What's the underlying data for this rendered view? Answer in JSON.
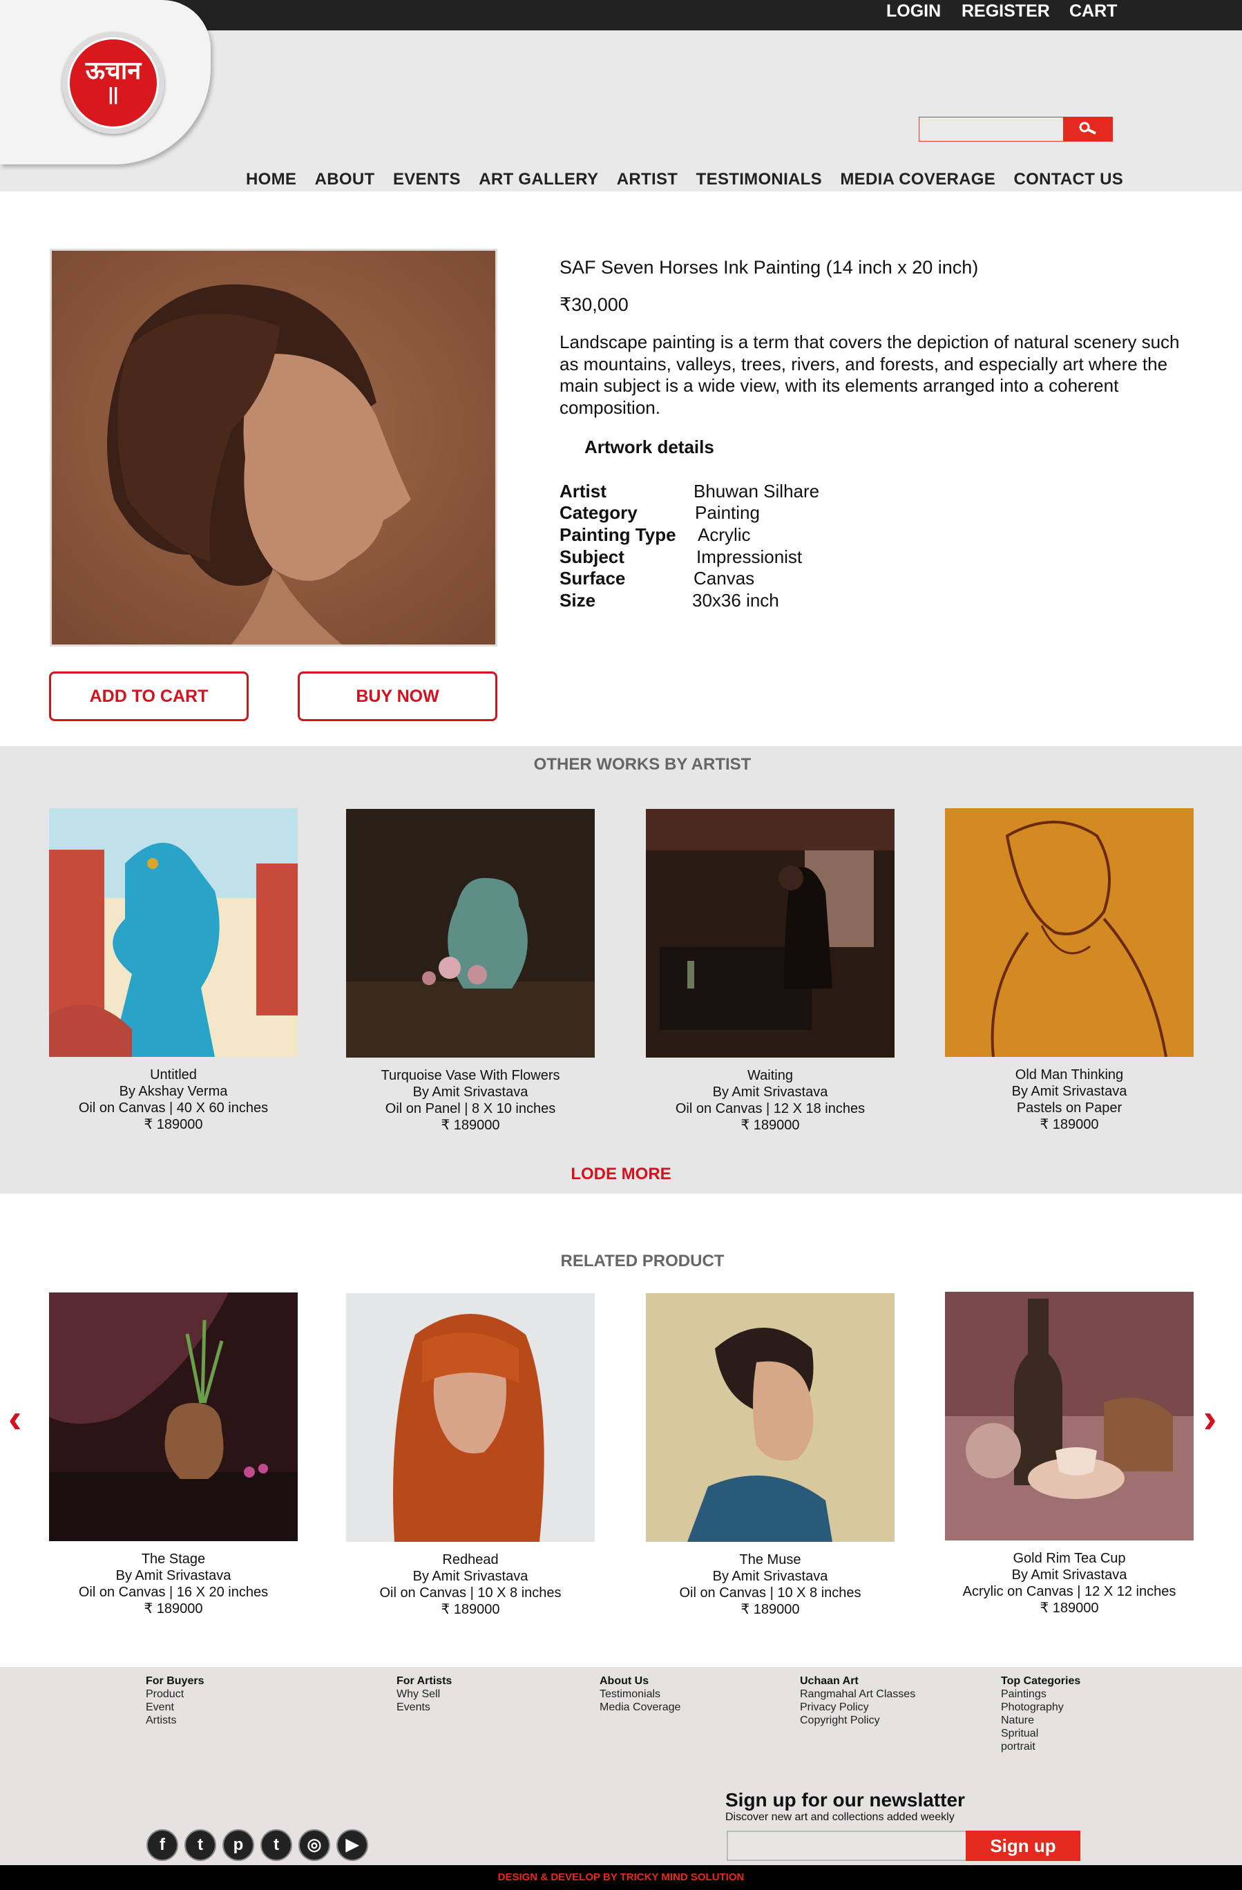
{
  "header": {
    "logo_text": "ऊचान",
    "top_links": [
      "LOGIN",
      "REGISTER",
      "CART"
    ],
    "search_placeholder": "",
    "nav": [
      "HOME",
      "ABOUT",
      "EVENTS",
      "ART GALLERY",
      "ARTIST",
      "TESTIMONIALS",
      "MEDIA COVERAGE",
      "CONTACT US"
    ]
  },
  "product": {
    "title": "SAF Seven Horses Ink Painting  (14 inch x 20 inch)",
    "price": "₹30,000",
    "description": "Landscape painting is a term that covers the depiction of natural scenery such as mountains, valleys, trees, rivers, and forests, and especially art where the main subject is a wide view, with its elements arranged into a coherent composition.",
    "details_heading": "Artwork details",
    "details": [
      {
        "label": "Artist",
        "value": "Bhuwan Silhare"
      },
      {
        "label": "Category",
        "value": "Painting"
      },
      {
        "label": "Painting Type",
        "value": "Acrylic"
      },
      {
        "label": "Subject",
        "value": "Impressionist"
      },
      {
        "label": "Surface",
        "value": "Canvas"
      },
      {
        "label": "Size",
        "value": "30x36 inch"
      }
    ],
    "add_to_cart": "ADD TO CART",
    "buy_now": "BUY NOW"
  },
  "other_works": {
    "heading": "OTHER WORKS BY ARTIST",
    "items": [
      {
        "title": "Untitled",
        "artist": "By Akshay Verma",
        "medium": "Oil on Canvas | 40 X 60 inches",
        "price": "₹ 189000"
      },
      {
        "title": "Turquoise Vase With Flowers",
        "artist": "By Amit Srivastava",
        "medium": "Oil on Panel | 8 X 10 inches",
        "price": "₹ 189000"
      },
      {
        "title": "Waiting",
        "artist": "By Amit Srivastava",
        "medium": "Oil on Canvas | 12 X 18 inches",
        "price": "₹ 189000"
      },
      {
        "title": "Old Man Thinking",
        "artist": "By Amit Srivastava",
        "medium": "Pastels on Paper",
        "price": "₹ 189000"
      }
    ],
    "load_more": "LODE MORE"
  },
  "related": {
    "heading": "RELATED PRODUCT",
    "prev": "‹",
    "next": "›",
    "items": [
      {
        "title": "The Stage",
        "artist": "By Amit Srivastava",
        "medium": "Oil on Canvas | 16 X 20 inches",
        "price": "₹ 189000"
      },
      {
        "title": "Redhead",
        "artist": "By Amit Srivastava",
        "medium": "Oil on Canvas | 10 X 8 inches",
        "price": "₹ 189000"
      },
      {
        "title": "The Muse",
        "artist": "By Amit Srivastava",
        "medium": "Oil on Canvas | 10 X 8 inches",
        "price": "₹ 189000"
      },
      {
        "title": "Gold Rim Tea Cup",
        "artist": "By Amit Srivastava",
        "medium": "Acrylic on Canvas | 12 X 12 inches",
        "price": "₹ 189000"
      }
    ]
  },
  "footer": {
    "columns": [
      {
        "heading": "For Buyers",
        "links": [
          "Product",
          "Event",
          "Artists"
        ]
      },
      {
        "heading": "For Artists",
        "links": [
          "Why Sell",
          "Events"
        ]
      },
      {
        "heading": "About Us",
        "links": [
          "Testimonials",
          "Media Coverage"
        ]
      },
      {
        "heading": "Uchaan Art",
        "links": [
          "Rangmahal Art Classes",
          "Privacy Policy",
          "Copyright Policy"
        ]
      },
      {
        "heading": "Top Categories",
        "links": [
          "Paintings",
          "Photography",
          "Nature",
          "Spritual",
          "portrait"
        ]
      }
    ],
    "newsletter_title": "Sign up for our newslatter",
    "newsletter_sub": "Discover new art and collections added weekly",
    "signup_button": "Sign up",
    "social": [
      {
        "icon": "facebook-icon",
        "glyph": "f"
      },
      {
        "icon": "twitter-icon",
        "glyph": "t"
      },
      {
        "icon": "pinterest-icon",
        "glyph": "p"
      },
      {
        "icon": "tumblr-icon",
        "glyph": "t"
      },
      {
        "icon": "instagram-icon",
        "glyph": "◎"
      },
      {
        "icon": "youtube-icon",
        "glyph": "▶"
      }
    ],
    "credit": "DESIGN & DEVELOP BY TRICKY MIND SOLUTION"
  },
  "colors": {
    "accent": "#e42a1f",
    "dark": "#222222",
    "panel": "#e6e6e6"
  }
}
